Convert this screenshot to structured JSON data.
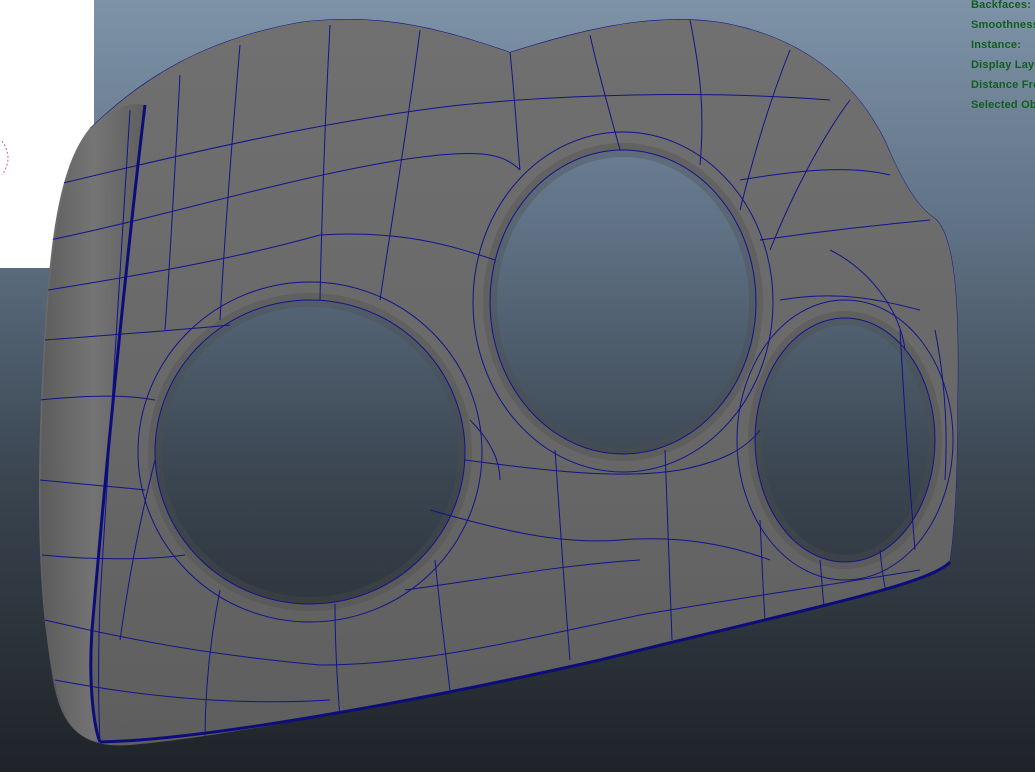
{
  "viewport": {
    "background_top": "#7e93a8",
    "background_bottom": "#1f2328",
    "mesh_color": "#6b6b6b",
    "wire_color": "#12148a",
    "hud_color": "#0f5e1c"
  },
  "hud": {
    "lines": [
      "Backfaces:",
      "Smoothness:",
      "Instance:",
      "Display Layer:",
      "Distance From Camera:",
      "Selected Objects:"
    ]
  }
}
